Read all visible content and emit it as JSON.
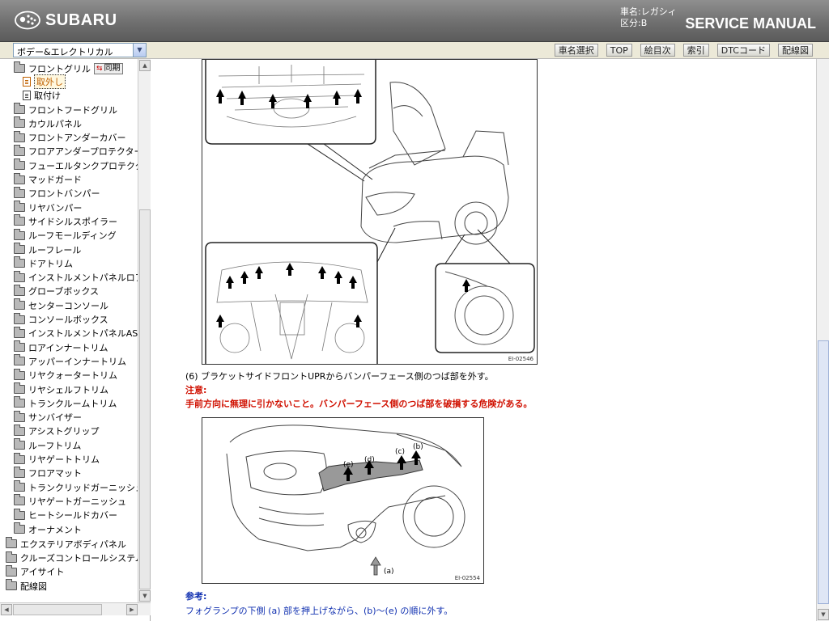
{
  "header": {
    "brand": "SUBARU",
    "car_name_line": "車名:レガシィ",
    "division_line": "区分:B",
    "title": "SERVICE MANUAL"
  },
  "toolbar": {
    "category_value": "ボデー&エレクトリカル",
    "buttons": [
      "車名選択",
      "TOP",
      "絵目次",
      "索引",
      "DTCコード",
      "配線図"
    ]
  },
  "sidebar": {
    "open_folder": "フロントグリル",
    "sync_label": "同期",
    "children": [
      "取外し",
      "取付け"
    ],
    "items": [
      "フロントフードグリル",
      "カウルパネル",
      "フロントアンダーカバー",
      "フロアアンダープロテクター",
      "フューエルタンクプロテクター",
      "マッドガード",
      "フロントバンパー",
      "リヤバンパー",
      "サイドシルスポイラー",
      "ルーフモールディング",
      "ルーフレール",
      "ドアトリム",
      "インストルメントパネルロアカバー",
      "グローブボックス",
      "センターコンソール",
      "コンソールボックス",
      "インストルメントパネルASSY",
      "ロアインナートリム",
      "アッパーインナートリム",
      "リヤクォータートリム",
      "リヤシェルフトリム",
      "トランクルームトリム",
      "サンバイザー",
      "アシストグリップ",
      "ルーフトリム",
      "リヤゲートトリム",
      "フロアマット",
      "トランクリッドガーニッシュ",
      "リヤゲートガーニッシュ",
      "ヒートシールドカバー",
      "オーナメント"
    ],
    "top_items": [
      "エクステリアボディパネル",
      "クルーズコントロールシステム",
      "アイサイト",
      "配線図"
    ]
  },
  "content": {
    "figure1_id": "EI-02546",
    "step6": "(6) ブラケットサイドフロントUPRからバンパーフェース側のつば部を外す。",
    "caution_heading": "注意:",
    "caution_text": "手前方向に無理に引かないこと。バンパーフェース側のつば部を破損する危険がある。",
    "figure2_id": "EI-02554",
    "figure2_labels": [
      "(a)",
      "(b)",
      "(c)",
      "(d)",
      "(e)"
    ],
    "reference_heading": "参考:",
    "reference_text": "フォグランプの下側 (a) 部を押上げながら、(b)〜(e) の順に外す。"
  },
  "icons": {
    "logo": "subaru-stars-icon",
    "folder": "folder-icon",
    "document": "document-icon",
    "sync": "sync-icon"
  }
}
